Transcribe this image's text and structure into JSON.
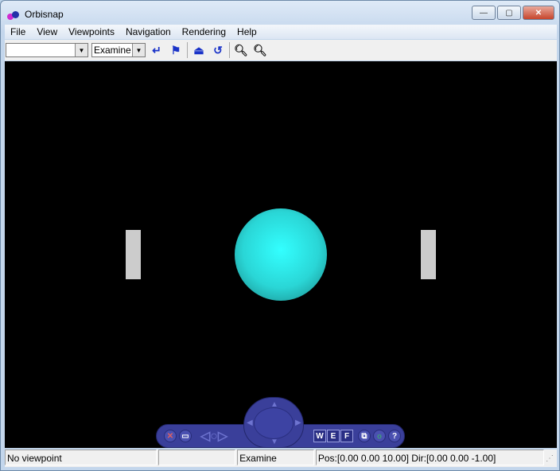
{
  "window": {
    "title": "Orbisnap",
    "minimize": "—",
    "maximize": "▢",
    "close": "✕"
  },
  "menu": [
    "File",
    "View",
    "Viewpoints",
    "Navigation",
    "Rendering",
    "Help"
  ],
  "toolbar": {
    "viewpoint_select": "",
    "nav_mode_select": "Examine",
    "icons": [
      "go-to-viewpoint-icon",
      "flag-icon",
      "straighten-up-icon",
      "undo-move-icon",
      "zoom-in-icon",
      "zoom-out-icon"
    ]
  },
  "nav_panel": {
    "w": "W",
    "e": "E",
    "f": "F",
    "help": "?"
  },
  "status": {
    "viewpoint": "No viewpoint",
    "blank": "",
    "mode": "Examine",
    "position": "Pos:[0.00 0.00 10.00] Dir:[0.00 0.00 -1.00]"
  },
  "colors": {
    "sphere": "#33ffff",
    "panel": "#3a3f9a"
  }
}
